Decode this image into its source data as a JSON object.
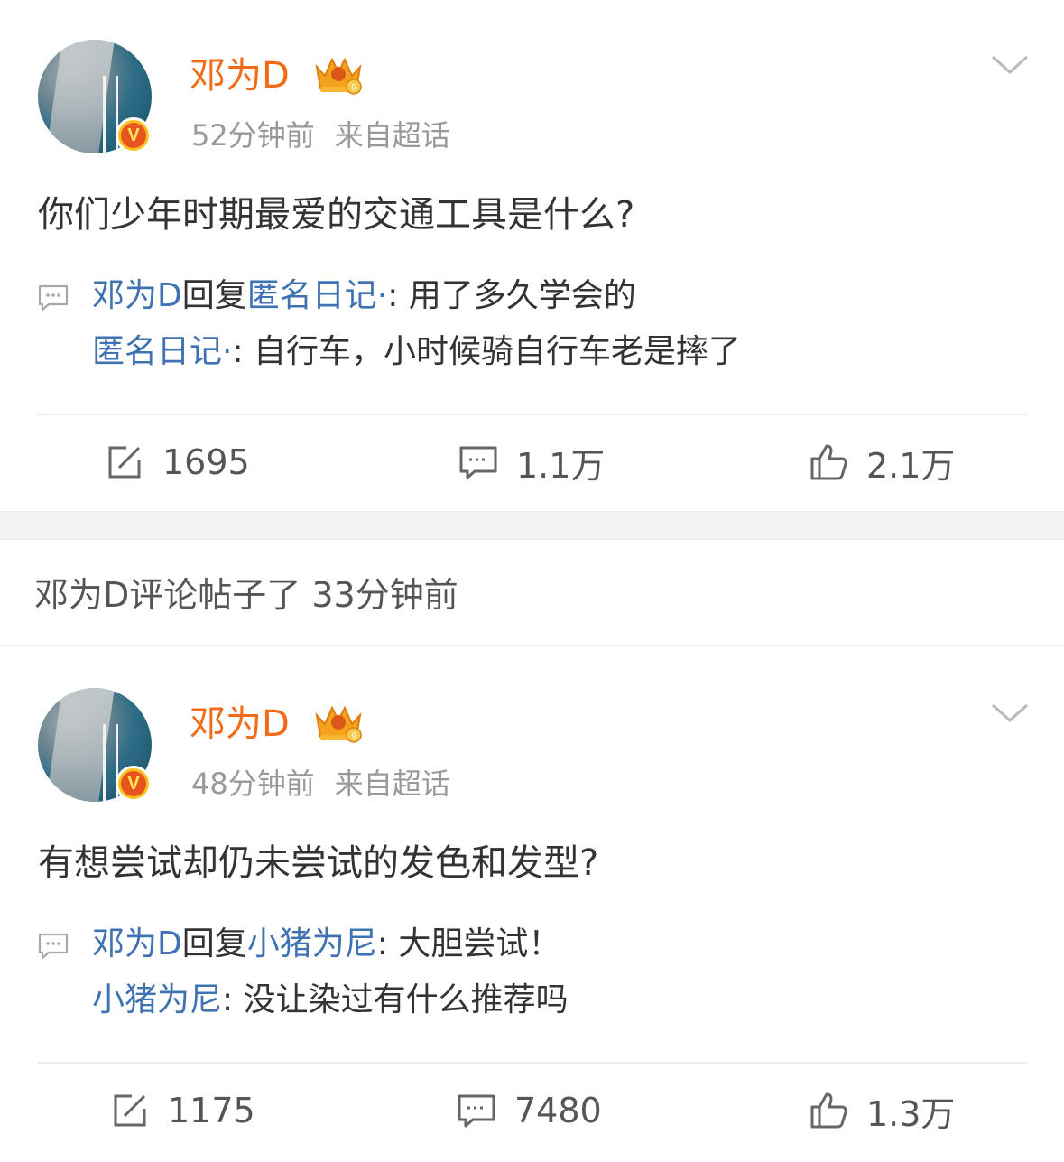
{
  "posts": [
    {
      "username": "邓为D",
      "time": "52分钟前",
      "source": "来自超话",
      "content": "你们少年时期最爱的交通工具是什么?",
      "replies": {
        "line1_author": "邓为D",
        "line1_verb": "回复",
        "line1_target": "匿名日记·",
        "line1_text": ": 用了多久学会的",
        "line2_author": "匿名日记·",
        "line2_text": ": 自行车，小时候骑自行车老是摔了"
      },
      "stats": {
        "repost": "1695",
        "comment": "1.1万",
        "like": "2.1万"
      }
    },
    {
      "username": "邓为D",
      "time": "48分钟前",
      "source": "来自超话",
      "content": "有想尝试却仍未尝试的发色和发型?",
      "replies": {
        "line1_author": "邓为D",
        "line1_verb": "回复",
        "line1_target": "小猪为尼",
        "line1_text": ": 大胆尝试！",
        "line2_author": "小猪为尼",
        "line2_text": ": 没让染过有什么推荐吗"
      },
      "stats": {
        "repost": "1175",
        "comment": "7480",
        "like": "1.3万"
      }
    }
  ],
  "activity": {
    "text": "邓为D评论帖子了 33分钟前"
  },
  "verified_badge": {
    "letter": "V"
  },
  "icons": {
    "repost": "repost-icon",
    "comment": "comment-icon",
    "like": "like-icon",
    "more": "chevron-down-icon",
    "reply": "reply-bubble-icon",
    "crown": "crown-badge-icon"
  },
  "colors": {
    "username": "#f36b17",
    "link": "#3e72b3",
    "meta": "#999999"
  }
}
